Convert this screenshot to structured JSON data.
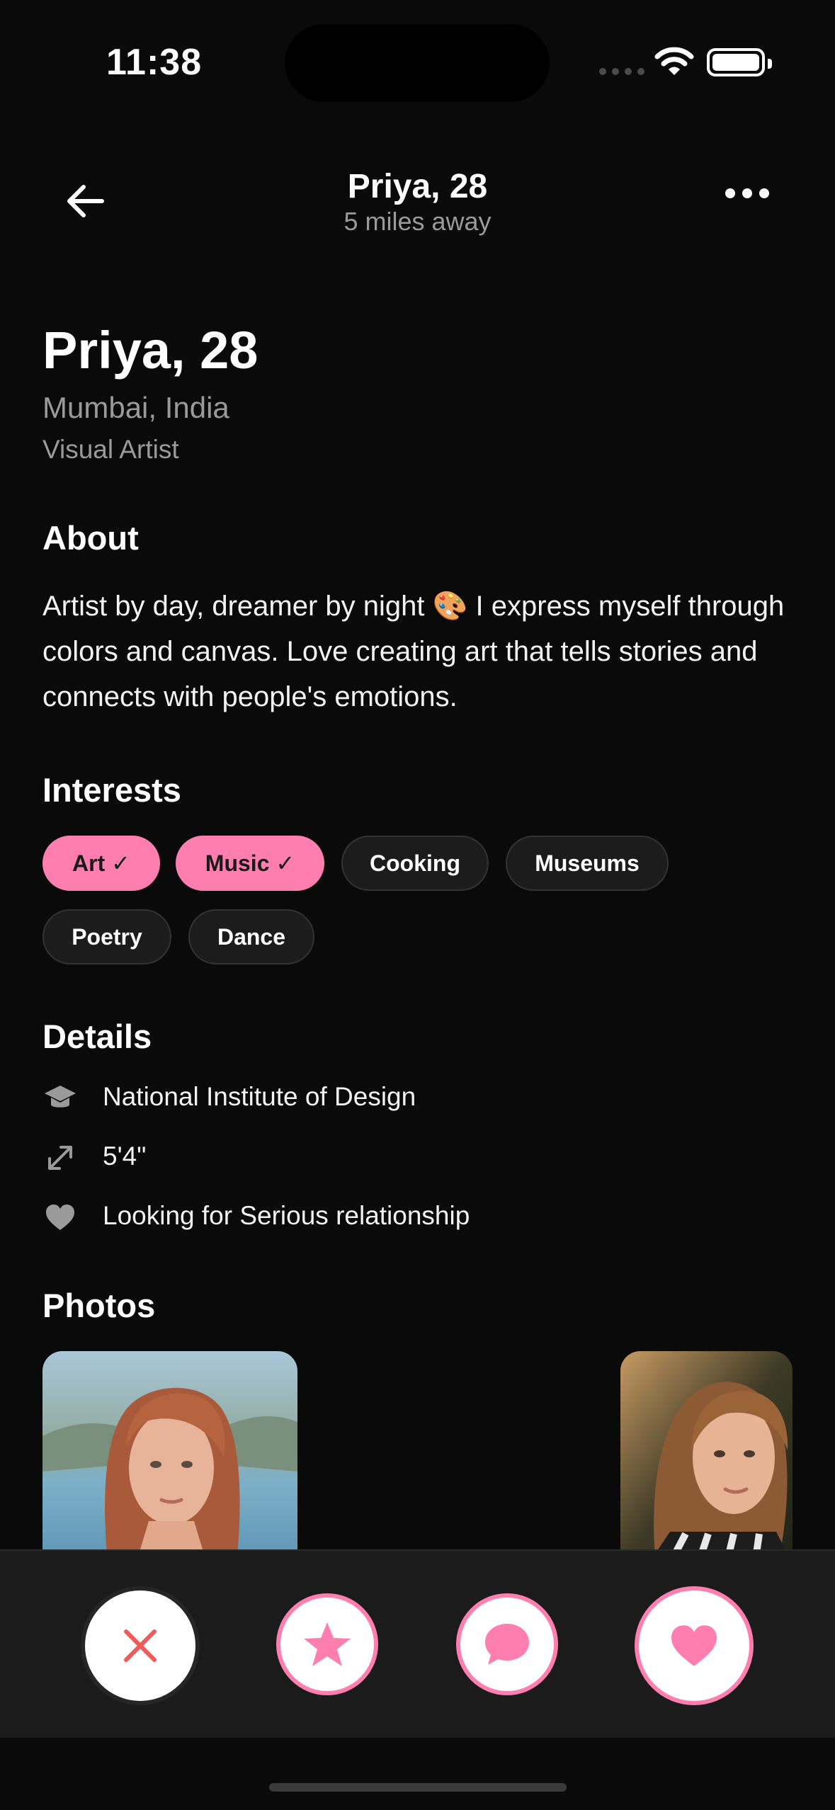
{
  "status_bar": {
    "time": "11:38"
  },
  "nav": {
    "title": "Priya, 28",
    "subtitle": "5 miles away"
  },
  "profile": {
    "name_age": "Priya, 28",
    "location": "Mumbai, India",
    "occupation": "Visual Artist"
  },
  "about": {
    "title": "About",
    "text": "Artist by day, dreamer by night 🎨 I express myself through colors and canvas. Love creating art that tells stories and connects with people's emotions."
  },
  "interests": {
    "title": "Interests",
    "items": [
      {
        "label": "Art ✓",
        "selected": true
      },
      {
        "label": "Music ✓",
        "selected": true
      },
      {
        "label": "Cooking",
        "selected": false
      },
      {
        "label": "Museums",
        "selected": false
      },
      {
        "label": "Poetry",
        "selected": false
      },
      {
        "label": "Dance",
        "selected": false
      }
    ]
  },
  "details": {
    "title": "Details",
    "items": [
      {
        "icon": "graduation-cap-icon",
        "text": "National Institute of Design"
      },
      {
        "icon": "height-arrows-icon",
        "text": "5'4\""
      },
      {
        "icon": "heart-icon",
        "text": "Looking for Serious relationship"
      }
    ]
  },
  "photos": {
    "title": "Photos"
  },
  "colors": {
    "accent": "#ff7eb0",
    "pass": "#ef5b5b",
    "background": "#0a0a0a"
  }
}
